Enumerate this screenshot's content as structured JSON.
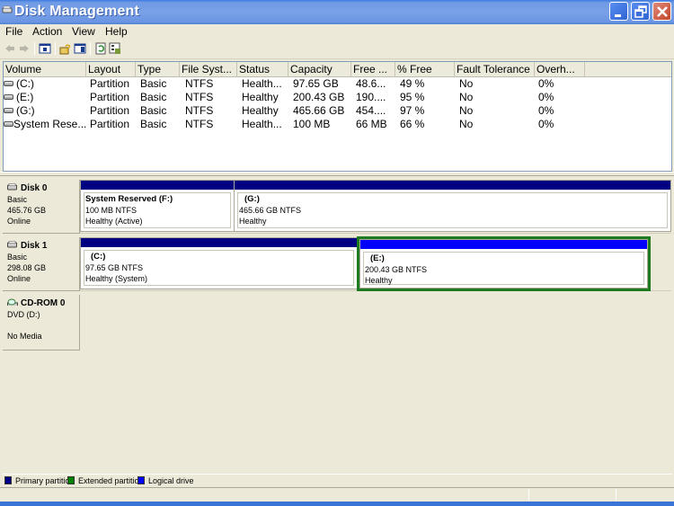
{
  "window": {
    "title": "Disk Management",
    "buttons": {
      "minimize": "minimize",
      "restore": "restore",
      "close": "close"
    }
  },
  "menu": [
    "File",
    "Action",
    "View",
    "Help"
  ],
  "toolbar": {
    "icons": [
      "back-arrow",
      "forward-arrow",
      "show-hide-console-tree",
      "help",
      "show-hide-action-pane",
      "refresh",
      "properties"
    ]
  },
  "volume_list": {
    "columns": [
      "Volume",
      "Layout",
      "Type",
      "File Syst...",
      "Status",
      "Capacity",
      "Free ...",
      "% Free",
      "Fault Tolerance",
      "Overh..."
    ],
    "rows": [
      [
        "(C:)",
        "Partition",
        "Basic",
        "NTFS",
        "Health...",
        "97.65 GB",
        "48.6...",
        "49 %",
        "No",
        "0%"
      ],
      [
        "(E:)",
        "Partition",
        "Basic",
        "NTFS",
        "Healthy",
        "200.43 GB",
        "190....",
        "95 %",
        "No",
        "0%"
      ],
      [
        "(G:)",
        "Partition",
        "Basic",
        "NTFS",
        "Healthy",
        "465.66 GB",
        "454....",
        "97 %",
        "No",
        "0%"
      ],
      [
        "System Rese...",
        "Partition",
        "Basic",
        "NTFS",
        "Health...",
        "100 MB",
        "66 MB",
        "66 %",
        "No",
        "0%"
      ]
    ]
  },
  "disks": [
    {
      "name": "Disk 0",
      "type": "Basic",
      "size": "465.76 GB",
      "state": "Online",
      "partitions": [
        {
          "title": "System Reserved  (F:)",
          "size": "100 MB NTFS",
          "status": "Healthy (Active)",
          "kind": "primary"
        },
        {
          "title": "(G:)",
          "size": "465.66 GB NTFS",
          "status": "Healthy",
          "kind": "primary"
        }
      ]
    },
    {
      "name": "Disk 1",
      "type": "Basic",
      "size": "298.08 GB",
      "state": "Online",
      "partitions": [
        {
          "title": "(C:)",
          "size": "97.65 GB NTFS",
          "status": "Healthy (System)",
          "kind": "primary"
        },
        {
          "title": "(E:)",
          "size": "200.43 GB NTFS",
          "status": "Healthy",
          "kind": "logical"
        }
      ]
    },
    {
      "name": "CD-ROM 0",
      "type": "DVD (D:)",
      "size": "",
      "state": "No Media",
      "partitions": []
    }
  ],
  "legend": [
    {
      "label": "Primary partition",
      "color": "#000080"
    },
    {
      "label": "Extended partition",
      "color": "#008000"
    },
    {
      "label": "Logical drive",
      "color": "#0000ff"
    }
  ],
  "colors": {
    "primary": "#000080",
    "extended": "#008000",
    "logical": "#0000ff"
  }
}
